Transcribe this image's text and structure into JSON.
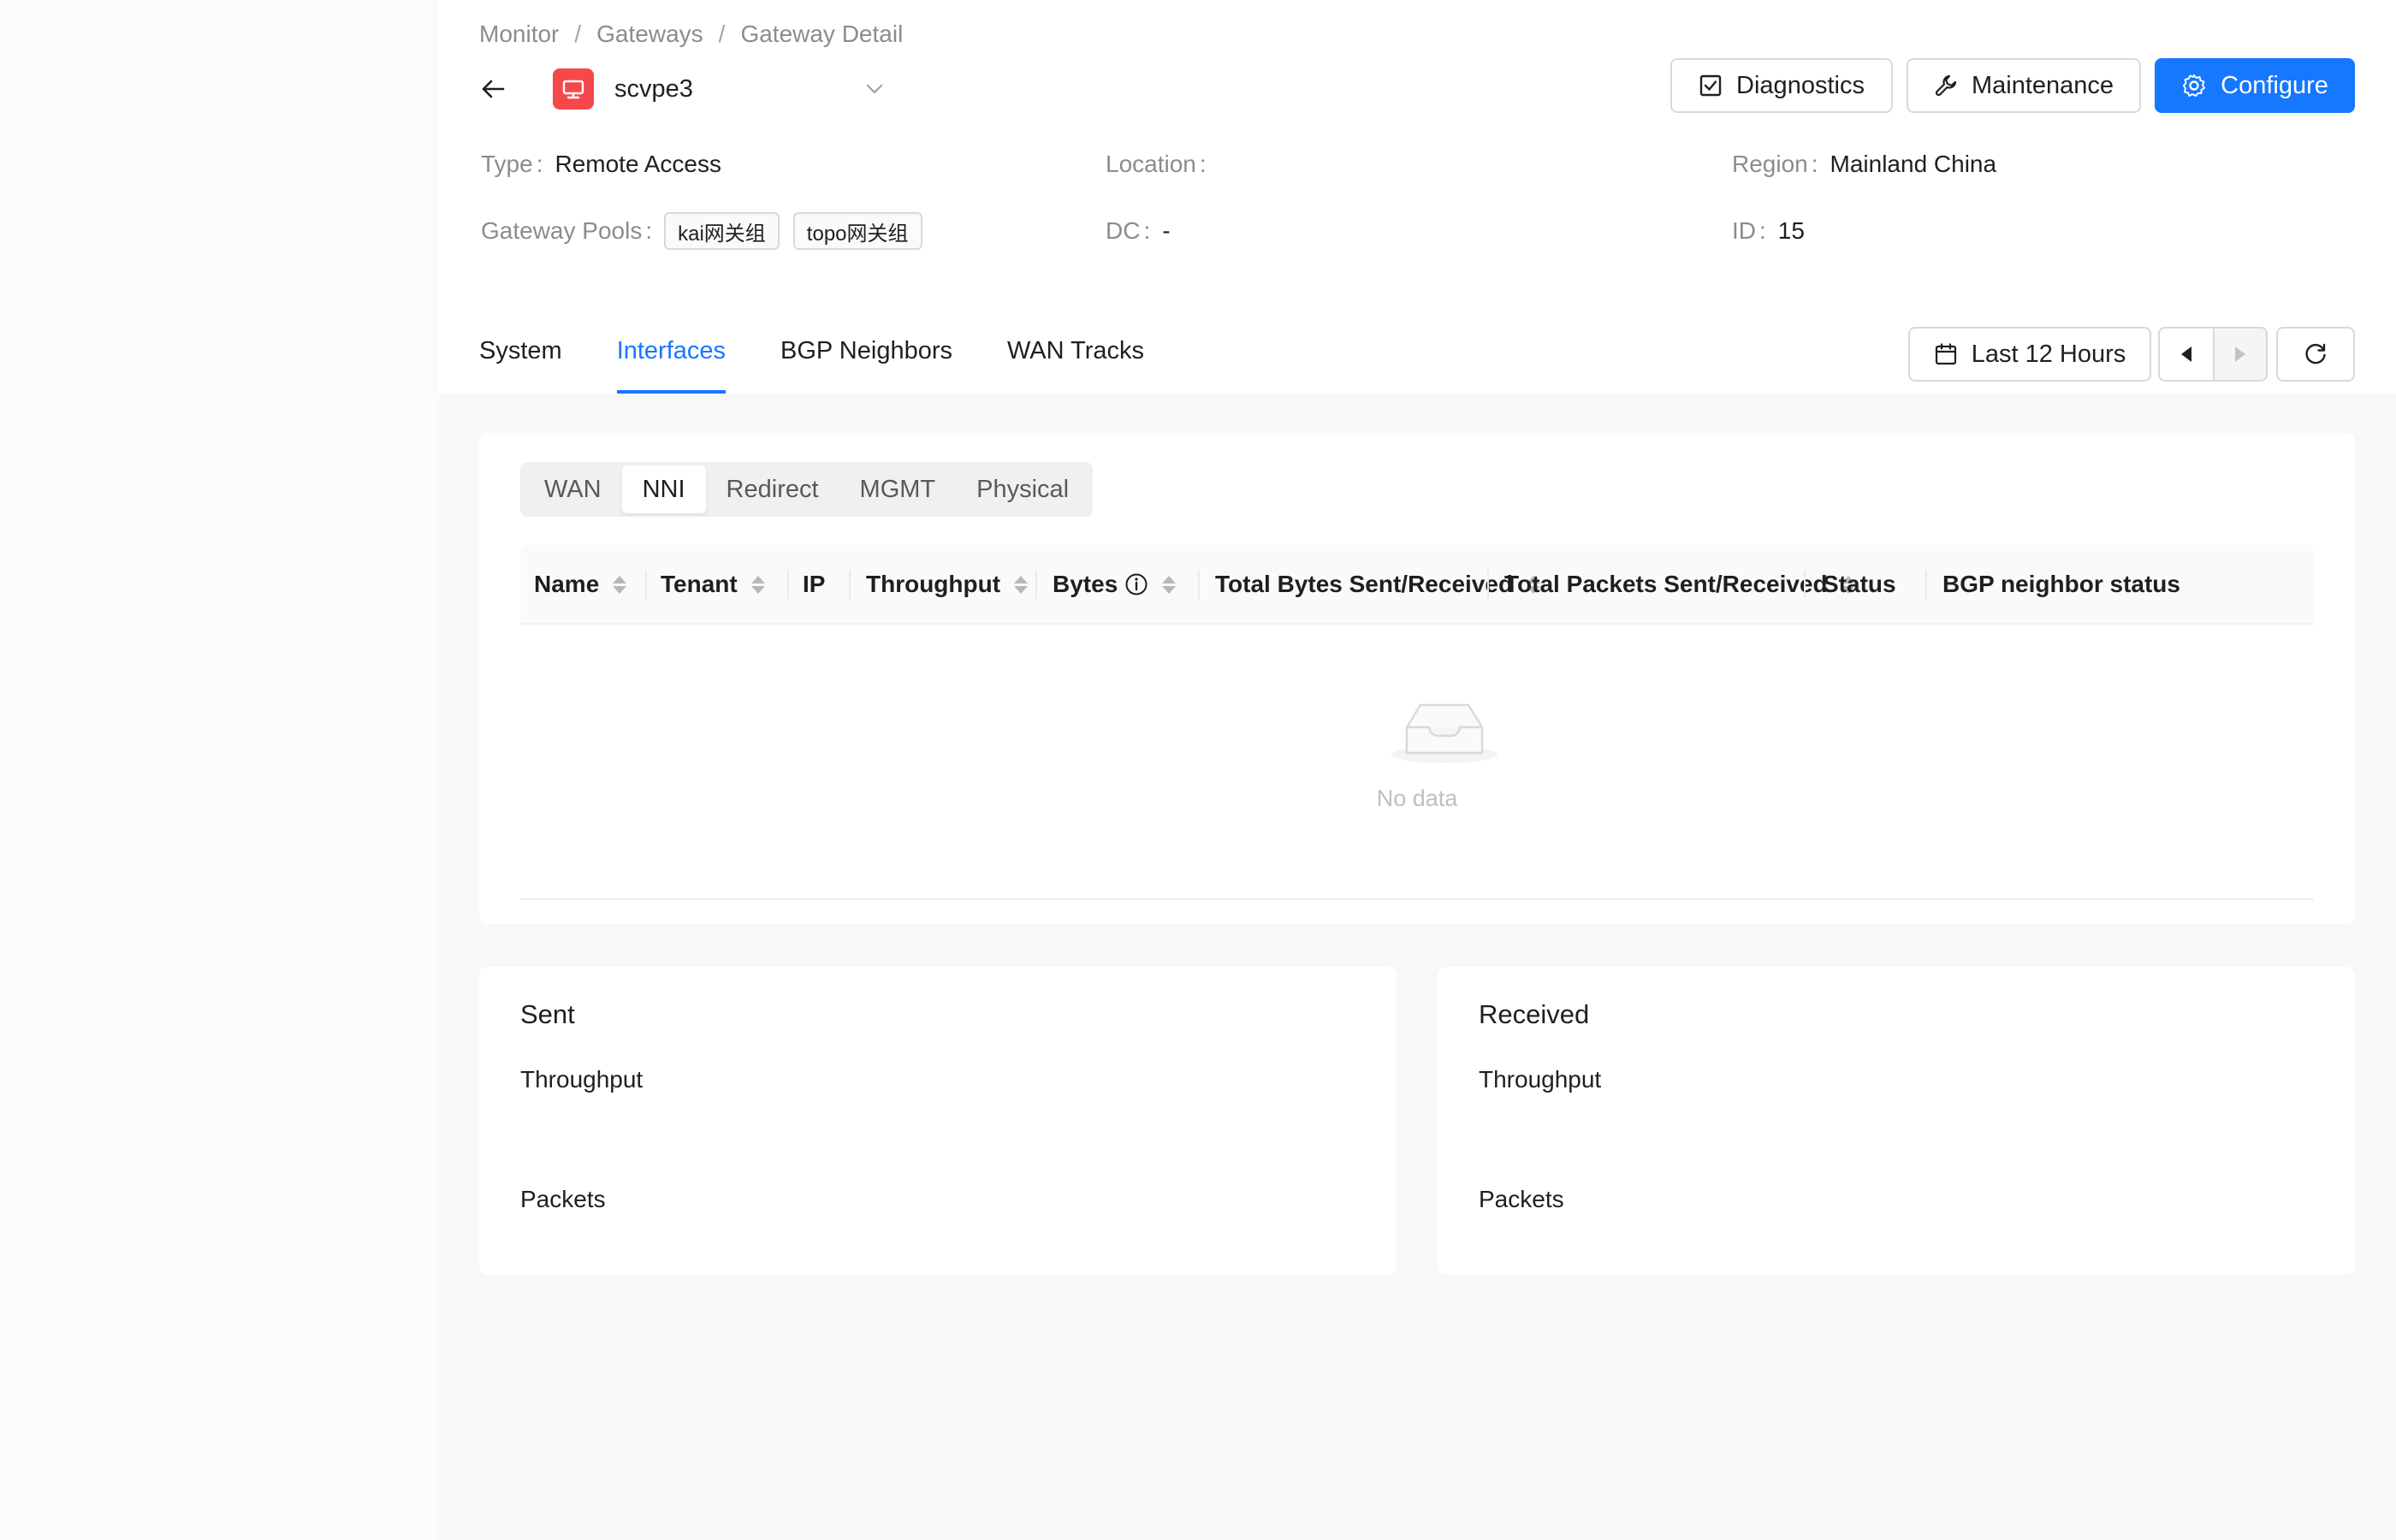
{
  "breadcrumb": [
    "Monitor",
    "Gateways",
    "Gateway Detail"
  ],
  "breadcrumb_separator": "/",
  "gateway": {
    "name": "scvpe3"
  },
  "actions": {
    "diagnostics": "Diagnostics",
    "maintenance": "Maintenance",
    "configure": "Configure"
  },
  "info": {
    "type_label": "Type",
    "type_value": "Remote Access",
    "location_label": "Location",
    "location_value": "",
    "region_label": "Region",
    "region_value": "Mainland China",
    "pools_label": "Gateway Pools",
    "pools": [
      "kai网关组",
      "topo网关组"
    ],
    "dc_label": "DC",
    "dc_value": "-",
    "id_label": "ID",
    "id_value": "15",
    "colon": ":"
  },
  "tabs": [
    {
      "label": "System",
      "active": false
    },
    {
      "label": "Interfaces",
      "active": true
    },
    {
      "label": "BGP Neighbors",
      "active": false
    },
    {
      "label": "WAN Tracks",
      "active": false
    }
  ],
  "toolbar": {
    "time_range": "Last 12 Hours"
  },
  "segments": [
    {
      "label": "WAN",
      "active": false
    },
    {
      "label": "NNI",
      "active": true
    },
    {
      "label": "Redirect",
      "active": false
    },
    {
      "label": "MGMT",
      "active": false
    },
    {
      "label": "Physical",
      "active": false
    }
  ],
  "table": {
    "columns": [
      "Name",
      "Tenant",
      "IP",
      "Throughput",
      "Bytes",
      "Total Bytes Sent/Received",
      "Total Packets Sent/Received",
      "Status",
      "BGP neighbor status"
    ],
    "empty_text": "No data"
  },
  "sent": {
    "title": "Sent",
    "throughput": "Throughput",
    "packets": "Packets"
  },
  "received": {
    "title": "Received",
    "throughput": "Throughput",
    "packets": "Packets"
  },
  "colors": {
    "primary": "#1677ff",
    "device_icon_bg": "#f5484b"
  }
}
